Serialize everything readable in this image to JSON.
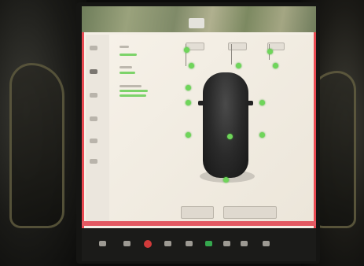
{
  "scene": {
    "description_visible_text": "",
    "colors": {
      "screen_background": "#f4efe6",
      "accent_red": "#e84a52",
      "sensor_green": "#6fd55a",
      "car_body": "#2a2a2a",
      "dock_background": "#1b1b19"
    }
  },
  "icons": {
    "sidebar": [
      "phone-icon",
      "car-icon",
      "lock-icon",
      "light-icon",
      "wrench-icon",
      "settings-icon"
    ],
    "dock": [
      "car-icon",
      "media-icon",
      "power-icon",
      "climate-icon",
      "fan-icon",
      "phone-icon",
      "app-icon",
      "app-icon",
      "volume-icon"
    ]
  },
  "parking_sensors": {
    "count_visible": 12
  }
}
